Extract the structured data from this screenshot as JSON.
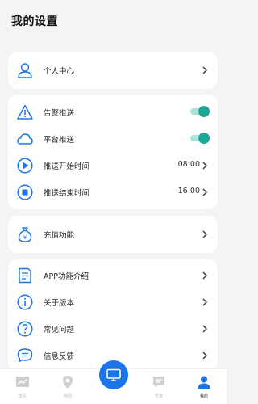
{
  "header": {
    "title": "我的设置"
  },
  "sections": {
    "profile": {
      "label": "个人中心"
    },
    "push": {
      "alarm_push": {
        "label": "告警推送",
        "enabled": true
      },
      "platform_push": {
        "label": "平台推送",
        "enabled": true
      },
      "push_start": {
        "label": "推送开始时间",
        "value": "08:00"
      },
      "push_end": {
        "label": "推送结束时间",
        "value": "16:00"
      }
    },
    "recharge": {
      "label": "充值功能"
    },
    "about": {
      "app_intro": {
        "label": "APP功能介绍"
      },
      "version": {
        "label": "关于版本"
      },
      "faq": {
        "label": "常见问题"
      },
      "feedback": {
        "label": "信息反馈"
      }
    }
  },
  "tabbar": {
    "tabs": [
      {
        "label": "首页",
        "icon": "chart-icon",
        "active": false
      },
      {
        "label": "地图",
        "icon": "map-pin-icon",
        "active": false
      },
      {
        "label": "",
        "icon": "monitor-icon",
        "active": false
      },
      {
        "label": "告警",
        "icon": "message-icon",
        "active": false
      },
      {
        "label": "我的",
        "icon": "user-icon",
        "active": true
      }
    ]
  },
  "colors": {
    "icon_blue": "#1b74e8",
    "toggle_on": "#1aa796",
    "toggle_track": "#a8e3da",
    "background": "#f3f4f6"
  }
}
